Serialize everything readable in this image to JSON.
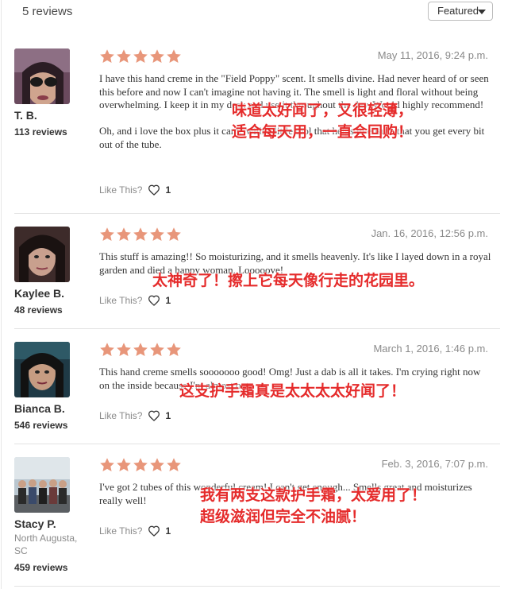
{
  "header": {
    "review_count": "5 reviews",
    "sort_selected": "Featured"
  },
  "colors": {
    "star": "#e8967a",
    "overlay_text": "#e52b2b"
  },
  "reviews": [
    {
      "author": "T. B.",
      "location": "",
      "review_count": "113 reviews",
      "rating": 5,
      "date": "May 11, 2016, 9:24 p.m.",
      "paragraphs": [
        "I have this hand creme in the \"Field Poppy\" scent. It smells divine. Had never heard of or seen this before and now I can't imagine not having it. The smell is light and floral without being overwhelming. I keep it in my desk and use it throughout the day. Would highly recommend!",
        "Oh, and i love the box plus it came with a little tool that helps to ensure that you get every bit out of the tube."
      ],
      "like_label": "Like This?",
      "likes": "1",
      "overlay": [
        "味道太好闻了，又很轻薄，",
        "适合每天用，一直会回购！"
      ]
    },
    {
      "author": "Kaylee B.",
      "location": "",
      "review_count": "48 reviews",
      "rating": 5,
      "date": "Jan. 16, 2016, 12:56 p.m.",
      "paragraphs": [
        "This stuff is amazing!! So moisturizing, and it smells heavenly. It's like I layed down in a royal garden and died a happy woman. Looooove!"
      ],
      "like_label": "Like This?",
      "likes": "1",
      "overlay": [
        "太神奇了！擦上它每天像行走的花园里。"
      ]
    },
    {
      "author": "Bianca B.",
      "location": "",
      "review_count": "546 reviews",
      "rating": 5,
      "date": "March 1, 2016, 1:46 p.m.",
      "paragraphs": [
        "This hand creme smells sooooooo good! Omg! Just a dab is all it takes. I'm crying right now on the inside because I'm almost out."
      ],
      "like_label": "Like This?",
      "likes": "1",
      "overlay": [
        "这支护手霜真是太太太太好闻了！"
      ]
    },
    {
      "author": "Stacy P.",
      "location": "North Augusta, SC",
      "review_count": "459 reviews",
      "rating": 5,
      "date": "Feb. 3, 2016, 7:07 p.m.",
      "paragraphs": [
        "I've got 2 tubes of this wonderful cream! I can't get enough... Smells great and moisturizes really well!"
      ],
      "like_label": "Like This?",
      "likes": "1",
      "overlay": [
        "我有两支这款护手霜，太爱用了！",
        "超级滋润但完全不油腻！"
      ]
    }
  ]
}
